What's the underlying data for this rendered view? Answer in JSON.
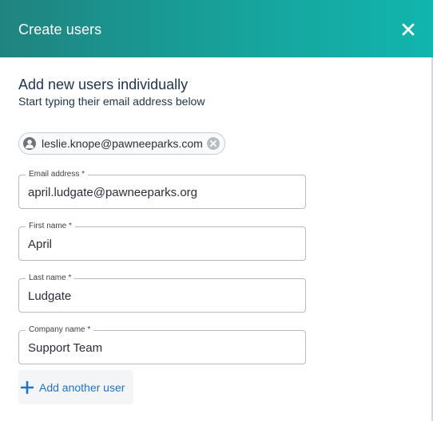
{
  "dialog": {
    "title": "Create users",
    "close_icon": "close-icon"
  },
  "section": {
    "title": "Add new users individually",
    "subtitle": "Start typing their email address below"
  },
  "selected_user_chip": {
    "email": "leslie.knope@pawneeparks.com",
    "avatar_icon": "user-avatar-icon",
    "remove_icon": "remove-circle-icon"
  },
  "form": {
    "email": {
      "label": "Email address *",
      "value": "april.ludgate@pawneeparks.org"
    },
    "first_name": {
      "label": "First name *",
      "value": "April"
    },
    "last_name": {
      "label": "Last name *",
      "value": "Ludgate"
    },
    "company_name": {
      "label": "Company name *",
      "value": "Support Team"
    }
  },
  "add_another": {
    "label": "Add another user",
    "icon": "plus-icon"
  },
  "colors": {
    "header_gradient_start": "#20837f",
    "header_gradient_end": "#11b5ad",
    "heading_text": "#22354f",
    "link_blue": "#1f73cc"
  }
}
